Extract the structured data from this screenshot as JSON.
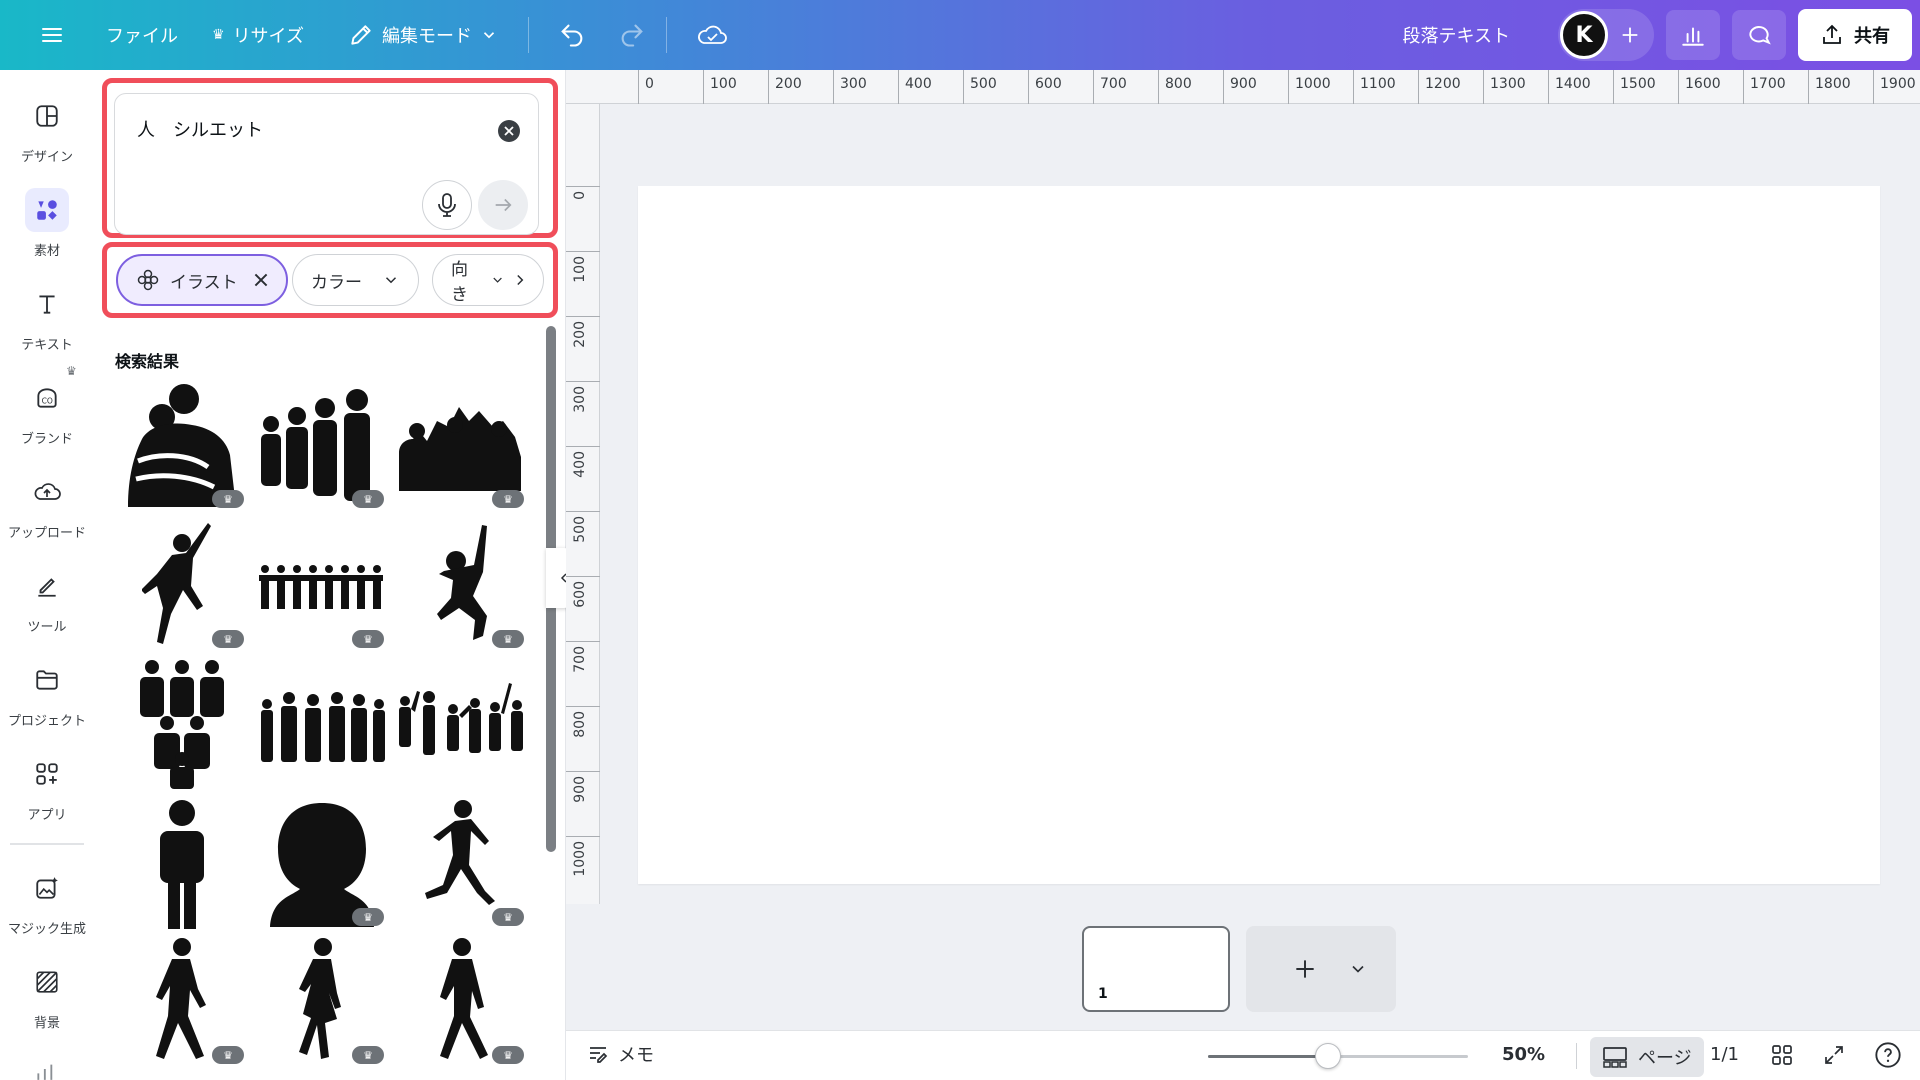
{
  "topbar": {
    "file_label": "ファイル",
    "resize_label": "リサイズ",
    "edit_mode_label": "編集モード",
    "text_type_label": "段落テキスト",
    "avatar_initial": "K",
    "share_label": "共有",
    "accent_gradient": [
      "#19b8c8",
      "#7b4fe4"
    ]
  },
  "rail": {
    "items": [
      {
        "label": "デザイン",
        "icon": "layout-icon"
      },
      {
        "label": "素材",
        "icon": "elements-icon"
      },
      {
        "label": "テキスト",
        "icon": "text-icon"
      },
      {
        "label": "ブランド",
        "icon": "brand-icon"
      },
      {
        "label": "アップロード",
        "icon": "upload-cloud-icon"
      },
      {
        "label": "ツール",
        "icon": "tools-icon"
      },
      {
        "label": "プロジェクト",
        "icon": "folder-icon"
      },
      {
        "label": "アプリ",
        "icon": "apps-icon"
      },
      {
        "label": "マジック生成",
        "icon": "magic-media-icon"
      },
      {
        "label": "背景",
        "icon": "background-icon"
      }
    ]
  },
  "search": {
    "query": "人　シルエット",
    "highlight_color": "#f04e5a"
  },
  "filters": {
    "chips": [
      {
        "label": "イラスト",
        "selected": true
      },
      {
        "label": "カラー",
        "selected": false
      },
      {
        "label": "向き",
        "selected": false
      }
    ]
  },
  "results": {
    "title": "検索結果",
    "items": [
      {
        "icon": "hugging-couple-silhouette",
        "premium": true
      },
      {
        "icon": "group-figures-silhouette",
        "premium": true
      },
      {
        "icon": "cheering-crowd-silhouette",
        "premium": true
      },
      {
        "icon": "jumping-man-silhouette",
        "premium": true
      },
      {
        "icon": "holding-hands-row-silhouette",
        "premium": true
      },
      {
        "icon": "jumping-woman-silhouette",
        "premium": true
      },
      {
        "icon": "team-icon-silhouette",
        "premium": false
      },
      {
        "icon": "business-group-silhouette",
        "premium": false
      },
      {
        "icon": "celebrating-crowd-silhouette",
        "premium": false
      },
      {
        "icon": "person-pictogram",
        "premium": false
      },
      {
        "icon": "head-bust-silhouette",
        "premium": true
      },
      {
        "icon": "running-businessman-silhouette",
        "premium": true
      },
      {
        "icon": "walking-man-silhouette",
        "premium": true
      },
      {
        "icon": "walking-woman-silhouette",
        "premium": true
      },
      {
        "icon": "walking-businesswoman-silhouette",
        "premium": true
      }
    ]
  },
  "ruler": {
    "top_ticks": [
      "0",
      "100",
      "200",
      "300",
      "400",
      "500",
      "600",
      "700",
      "800",
      "900",
      "1000",
      "1100",
      "1200",
      "1300",
      "1400",
      "1500",
      "1600",
      "1700",
      "1800",
      "1900"
    ],
    "left_ticks": [
      "0",
      "100",
      "200",
      "300",
      "400",
      "500",
      "600",
      "700",
      "800",
      "900",
      "1000"
    ]
  },
  "pages": {
    "current_page_number": "1",
    "page_count_label": "1/1"
  },
  "bottombar": {
    "notes_label": "メモ",
    "zoom_label": "50%",
    "zoom_fraction": 0.46,
    "view_label": "ページ"
  }
}
